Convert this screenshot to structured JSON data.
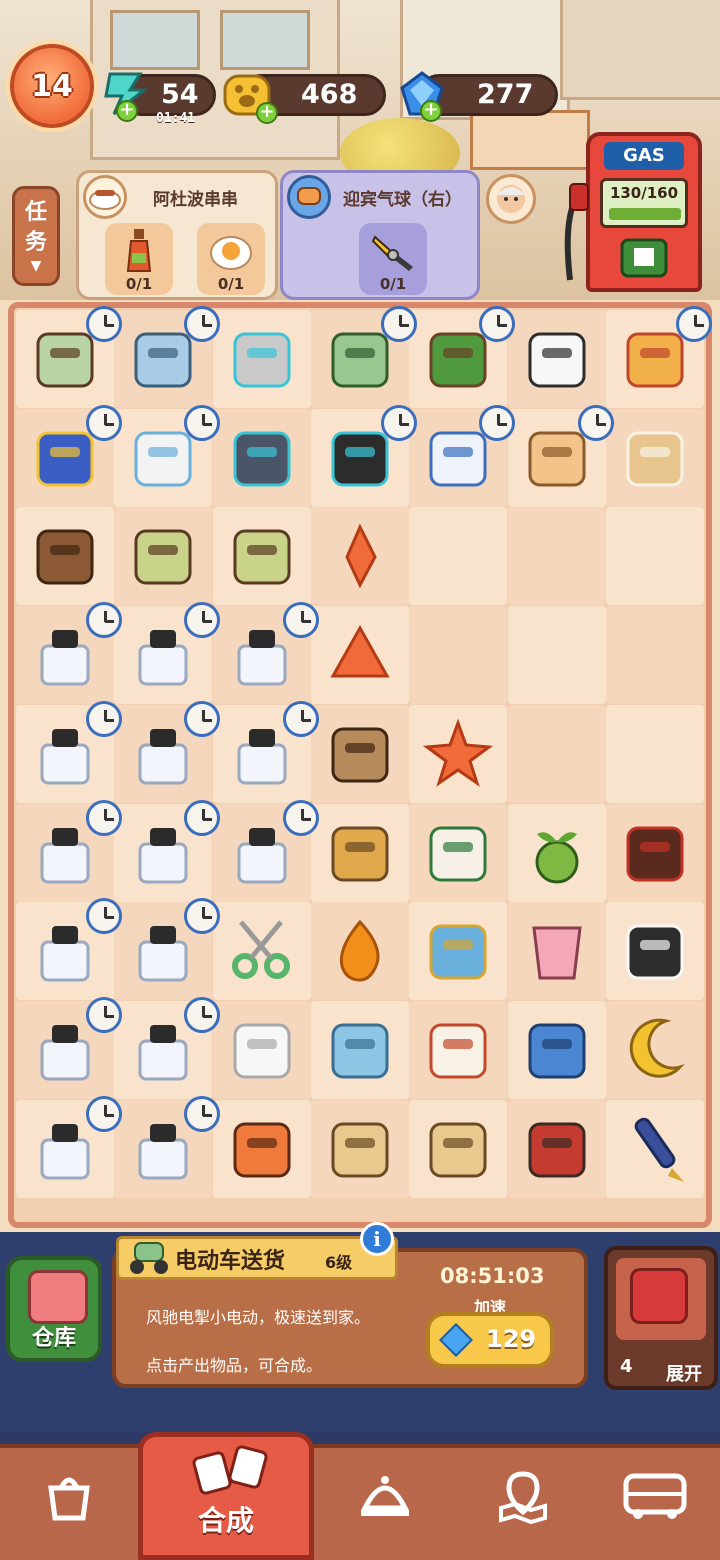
{
  "header": {
    "level": "14",
    "energy": {
      "value": "54",
      "timer": "01:41"
    },
    "coins": {
      "value": "468"
    },
    "gems": {
      "value": "277"
    }
  },
  "tasks": {
    "tab_label_1": "任",
    "tab_label_2": "务",
    "cards": [
      {
        "title": "阿杜波串串",
        "requirements": [
          {
            "icon": "sauce-bottle",
            "count": "0/1"
          },
          {
            "icon": "fried-egg",
            "count": "0/1"
          }
        ]
      },
      {
        "title": "迎宾气球（右）",
        "requirements": [
          {
            "icon": "pliers",
            "count": "0/1"
          }
        ]
      }
    ]
  },
  "gas_station": {
    "label": "GAS",
    "fuel": "130/160"
  },
  "board": {
    "cols": 7,
    "rows": 9,
    "items": [
      {
        "r": 0,
        "c": 0,
        "icon": "skewer-pot",
        "clock": true
      },
      {
        "r": 0,
        "c": 1,
        "icon": "cabinet",
        "clock": true
      },
      {
        "r": 0,
        "c": 2,
        "icon": "locked-box",
        "clock": false
      },
      {
        "r": 0,
        "c": 3,
        "icon": "scooter",
        "clock": true
      },
      {
        "r": 0,
        "c": 4,
        "icon": "bonsai-tree",
        "clock": true
      },
      {
        "r": 0,
        "c": 5,
        "icon": "cat-paw",
        "clock": false
      },
      {
        "r": 0,
        "c": 6,
        "icon": "envelope-box",
        "clock": true
      },
      {
        "r": 1,
        "c": 0,
        "icon": "star-horn",
        "clock": true
      },
      {
        "r": 1,
        "c": 1,
        "icon": "printer",
        "clock": true
      },
      {
        "r": 1,
        "c": 2,
        "icon": "chef-hat-locked",
        "clock": false
      },
      {
        "r": 1,
        "c": 3,
        "icon": "rolls-locked",
        "clock": true
      },
      {
        "r": 1,
        "c": 4,
        "icon": "notebook",
        "clock": true
      },
      {
        "r": 1,
        "c": 5,
        "icon": "spice-rack",
        "clock": true
      },
      {
        "r": 1,
        "c": 6,
        "icon": "rice-tray",
        "clock": false
      },
      {
        "r": 2,
        "c": 0,
        "icon": "noodle-bowl",
        "clock": false
      },
      {
        "r": 2,
        "c": 1,
        "icon": "noodle-mat",
        "clock": false
      },
      {
        "r": 2,
        "c": 2,
        "icon": "noodle-mat",
        "clock": false
      },
      {
        "r": 2,
        "c": 3,
        "icon": "orange-shard",
        "clock": false
      },
      {
        "r": 3,
        "c": 0,
        "icon": "ink-bottle",
        "clock": true
      },
      {
        "r": 3,
        "c": 1,
        "icon": "ink-bottle",
        "clock": true
      },
      {
        "r": 3,
        "c": 2,
        "icon": "ink-bottle",
        "clock": true
      },
      {
        "r": 3,
        "c": 3,
        "icon": "orange-triangle",
        "clock": false
      },
      {
        "r": 4,
        "c": 0,
        "icon": "ink-bottle",
        "clock": true
      },
      {
        "r": 4,
        "c": 1,
        "icon": "ink-bottle",
        "clock": true
      },
      {
        "r": 4,
        "c": 2,
        "icon": "ink-bottle",
        "clock": true
      },
      {
        "r": 4,
        "c": 3,
        "icon": "noodle-plate",
        "clock": false
      },
      {
        "r": 4,
        "c": 4,
        "icon": "orange-star",
        "clock": false
      },
      {
        "r": 5,
        "c": 0,
        "icon": "ink-bottle",
        "clock": true
      },
      {
        "r": 5,
        "c": 1,
        "icon": "ink-bottle",
        "clock": true
      },
      {
        "r": 5,
        "c": 2,
        "icon": "ink-bottle",
        "clock": true
      },
      {
        "r": 5,
        "c": 3,
        "icon": "paper-bag",
        "clock": false
      },
      {
        "r": 5,
        "c": 4,
        "icon": "calendar",
        "clock": false
      },
      {
        "r": 5,
        "c": 5,
        "icon": "sprout",
        "clock": false
      },
      {
        "r": 5,
        "c": 6,
        "icon": "chili-jar",
        "clock": false
      },
      {
        "r": 6,
        "c": 0,
        "icon": "ink-bottle",
        "clock": true
      },
      {
        "r": 6,
        "c": 1,
        "icon": "ink-bottle",
        "clock": true
      },
      {
        "r": 6,
        "c": 2,
        "icon": "scissors",
        "clock": false
      },
      {
        "r": 6,
        "c": 3,
        "icon": "orange-drop",
        "clock": false
      },
      {
        "r": 6,
        "c": 4,
        "icon": "tag-keychain",
        "clock": false
      },
      {
        "r": 6,
        "c": 5,
        "icon": "pink-cup",
        "clock": false
      },
      {
        "r": 6,
        "c": 6,
        "icon": "sushi-roll",
        "clock": false
      },
      {
        "r": 7,
        "c": 0,
        "icon": "ink-bottle",
        "clock": true
      },
      {
        "r": 7,
        "c": 1,
        "icon": "ink-bottle",
        "clock": true
      },
      {
        "r": 7,
        "c": 2,
        "icon": "sugar-cubes",
        "clock": false
      },
      {
        "r": 7,
        "c": 3,
        "icon": "puzzle-pieces",
        "clock": false
      },
      {
        "r": 7,
        "c": 4,
        "icon": "rice-sack",
        "clock": false
      },
      {
        "r": 7,
        "c": 5,
        "icon": "blue-bag",
        "clock": false
      },
      {
        "r": 7,
        "c": 6,
        "icon": "crescent-moon",
        "clock": false
      },
      {
        "r": 8,
        "c": 0,
        "icon": "ink-bottle",
        "clock": true
      },
      {
        "r": 8,
        "c": 1,
        "icon": "ink-bottle",
        "clock": true
      },
      {
        "r": 8,
        "c": 2,
        "icon": "shrimp-bowl",
        "clock": false
      },
      {
        "r": 8,
        "c": 3,
        "icon": "delivery-bag",
        "clock": false
      },
      {
        "r": 8,
        "c": 4,
        "icon": "delivery-bag",
        "clock": false
      },
      {
        "r": 8,
        "c": 5,
        "icon": "braised-pot",
        "clock": false
      },
      {
        "r": 8,
        "c": 6,
        "icon": "fountain-pen",
        "clock": false
      }
    ]
  },
  "info": {
    "title": "电动车送货",
    "level": "6级",
    "description": "风驰电掣小电动，极速送到家。",
    "hint": "点击产出物品，可合成。",
    "timer": "08:51:03",
    "speed_label": "加速",
    "speed_cost": "129",
    "info_symbol": "i"
  },
  "warehouse": {
    "label": "仓库"
  },
  "expand": {
    "count": "4",
    "label": "展开"
  },
  "nav": {
    "active_label": "合成"
  },
  "colors": {
    "accent": "#e65b45",
    "board_bg": "#f1cfb0",
    "panel": "#b86e46"
  }
}
